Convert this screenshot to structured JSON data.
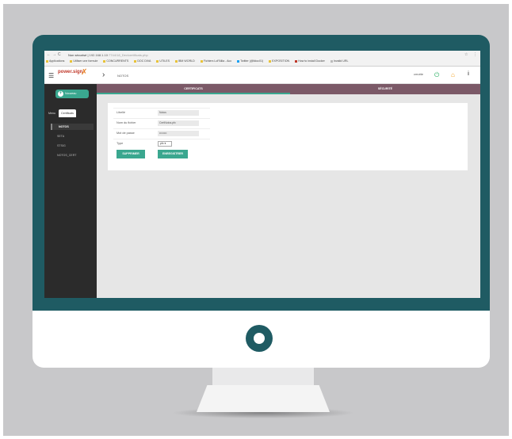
{
  "browser": {
    "nav": {
      "back": "←",
      "forward": "→",
      "reload": "C"
    },
    "security_text": "Non sécurisé",
    "url_host": "192.168.1.10",
    "url_path": ":7744/18_Dev/certificats.php",
    "star": "☆",
    "menu": "⋮",
    "bookmarks": [
      "Applications",
      "Utiliser une formule",
      "CONCURRENTS",
      "DOC DIVA",
      "UTILES",
      "IBM WORLD",
      "Fichiers LoFAllia - Acc",
      "Twitter (@lldoc01)",
      "EXPOSITION",
      "How to install Docker",
      "Invalid URL"
    ]
  },
  "app": {
    "logo": "power.sign",
    "breadcrumb": "NOTOS",
    "user": "cmotte",
    "sidebar": {
      "new_button": "Nouveau",
      "tabs": [
        "Menu",
        "Certificats"
      ],
      "items": [
        "NOTOS",
        "SETA",
        "STSIG",
        "NOTOS_CERT"
      ]
    },
    "tabs": [
      "CERTIFICATS",
      "SÉCURITÉ"
    ],
    "form": {
      "rows": [
        {
          "label": "Libellé",
          "value": "Notos"
        },
        {
          "label": "Nom du fichier",
          "value": "CertNotos.pfx"
        },
        {
          "label": "Mot de passe",
          "value": "••••••••"
        },
        {
          "label": "Type",
          "value": "pfx ▾"
        }
      ],
      "delete_button": "SUPPRIMER",
      "save_button": "ENREGISTRER"
    }
  },
  "colors": {
    "bezel": "#1f5b63",
    "accent": "#3aa78f",
    "tab": "#7b5967",
    "sidebar": "#2b2b2b"
  }
}
